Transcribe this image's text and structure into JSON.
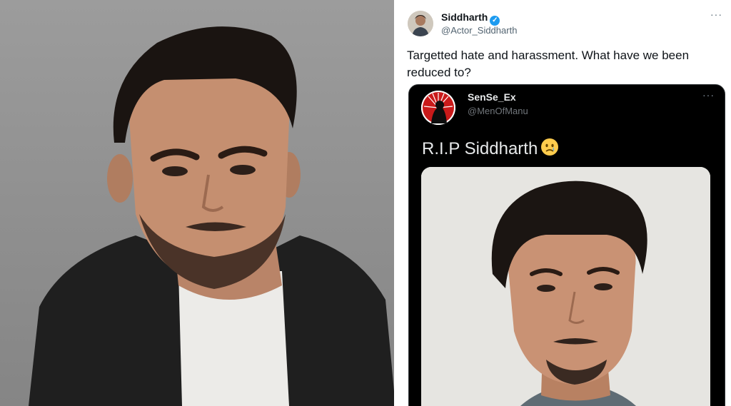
{
  "tweet": {
    "author_name": "Siddharth",
    "author_handle": "@Actor_Siddharth",
    "more_label": "···",
    "text": "Targetted hate and harassment. What have we been reduced to?"
  },
  "quoted_tweet": {
    "author_name": "SenSe_Ex",
    "author_handle": "@MenOfManu",
    "more_label": "···",
    "text": "R.I.P Siddharth"
  },
  "icons": {
    "verified": "verified-badge-icon",
    "emoji": "crying-face-emoji-icon",
    "more": "more-options-icon"
  },
  "colors": {
    "verified_blue": "#1d9bf0",
    "quote_background": "#000000",
    "photo_background": "#8f8f8f"
  }
}
